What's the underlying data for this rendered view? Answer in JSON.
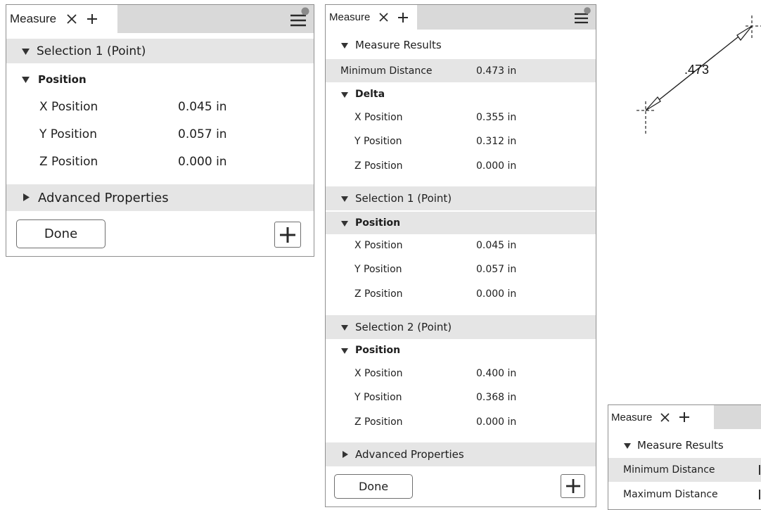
{
  "panel1": {
    "tab_label": "Measure",
    "selection_header": "Selection 1 (Point)",
    "position_header": "Position",
    "rows": [
      {
        "label": "X Position",
        "value": "0.045 in"
      },
      {
        "label": "Y Position",
        "value": "0.057 in"
      },
      {
        "label": "Z Position",
        "value": "0.000 in"
      }
    ],
    "advanced_label": "Advanced Properties",
    "done_label": "Done"
  },
  "panel2": {
    "tab_label": "Measure",
    "results_header": "Measure Results",
    "min_distance_label": "Minimum Distance",
    "min_distance_value": "0.473 in",
    "delta_header": "Delta",
    "delta_rows": [
      {
        "label": "X Position",
        "value": "0.355 in"
      },
      {
        "label": "Y Position",
        "value": "0.312 in"
      },
      {
        "label": "Z Position",
        "value": "0.000 in"
      }
    ],
    "selection1_header": "Selection 1 (Point)",
    "selection1_position_header": "Position",
    "selection1_rows": [
      {
        "label": "X Position",
        "value": "0.045 in"
      },
      {
        "label": "Y Position",
        "value": "0.057 in"
      },
      {
        "label": "Z Position",
        "value": "0.000 in"
      }
    ],
    "selection2_header": "Selection 2 (Point)",
    "selection2_position_header": "Position",
    "selection2_rows": [
      {
        "label": "X Position",
        "value": "0.400 in"
      },
      {
        "label": "Y Position",
        "value": "0.368 in"
      },
      {
        "label": "Z Position",
        "value": "0.000 in"
      }
    ],
    "advanced_label": "Advanced Properties",
    "done_label": "Done"
  },
  "panel3": {
    "tab_label": "Measure",
    "results_header": "Measure Results",
    "min_distance_label": "Minimum Distance",
    "max_distance_label": "Maximum Distance"
  },
  "drawing": {
    "dimension_text": ".473"
  },
  "icons": {
    "close": "close-icon",
    "add_tab": "plus-icon",
    "menu": "menu-icon",
    "add": "add-icon",
    "expand": "triangle-down-icon",
    "collapse": "triangle-right-icon"
  },
  "colors": {
    "tabbar_bg": "#d9d9d9",
    "row_shade": "#e5e5e5",
    "border": "#8f8f8f",
    "text": "#1e1e1e",
    "menu_dot": "#8a8a8a"
  }
}
